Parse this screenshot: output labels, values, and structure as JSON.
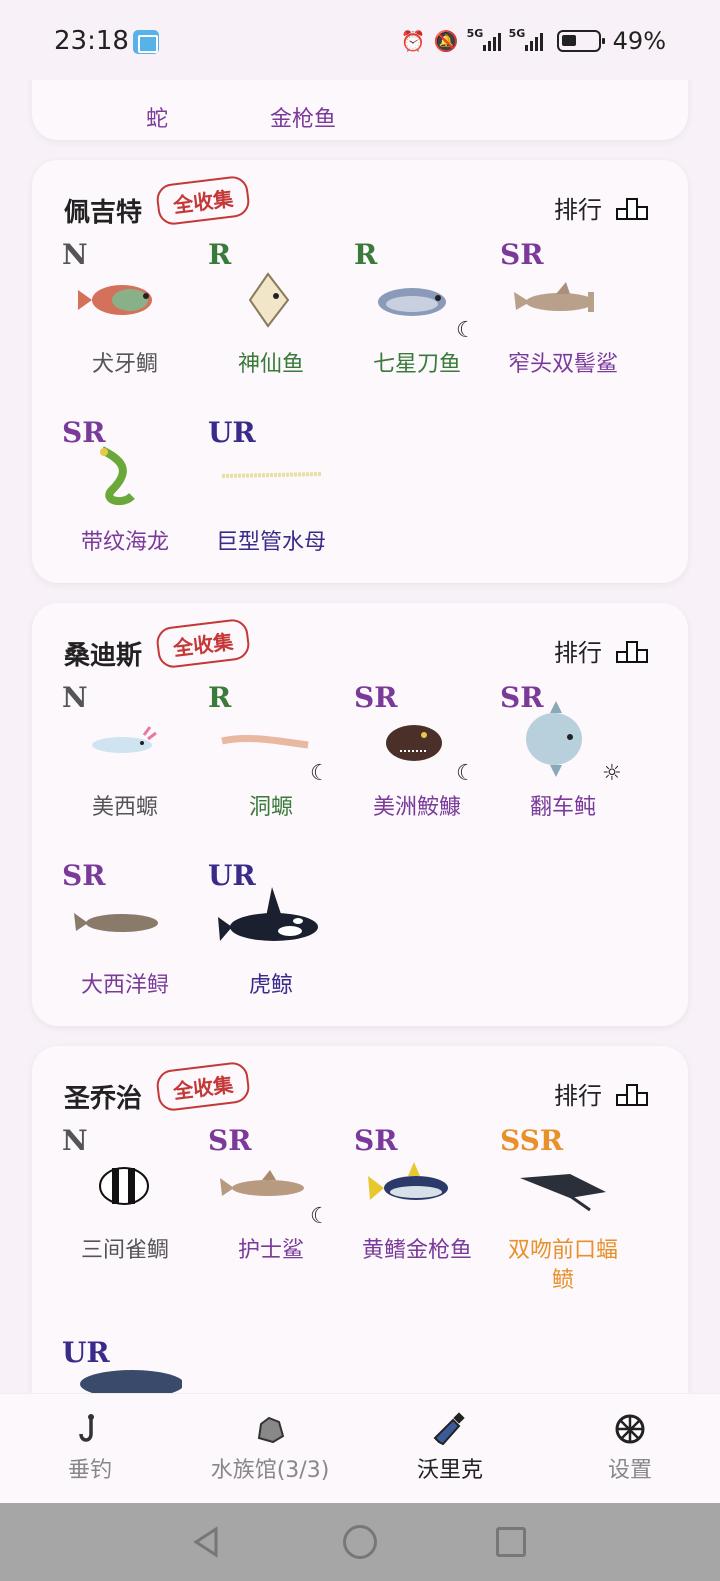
{
  "status_bar": {
    "time": "23:18",
    "battery": "49%",
    "signal_1": "5G",
    "signal_2": "5G",
    "icons": [
      "alarm-icon",
      "mute-icon",
      "signal-icon",
      "signal-icon",
      "battery-icon"
    ]
  },
  "top_card": {
    "fish": [
      {
        "name_line2": "蛇",
        "rarity_color": "#7a3a9a"
      },
      {
        "name_line2": "金枪鱼",
        "rarity_color": "#7a3a9a"
      }
    ]
  },
  "regions": [
    {
      "title": "佩吉特",
      "badge": "全收集",
      "rank_label": "排行",
      "fish": [
        {
          "rarity": "N",
          "name": "犬牙鲷",
          "time": ""
        },
        {
          "rarity": "R",
          "name": "神仙鱼",
          "time": ""
        },
        {
          "rarity": "R",
          "name": "七星刀鱼",
          "time": "☾"
        },
        {
          "rarity": "SR",
          "name": "窄头双髻鲨",
          "time": ""
        },
        {
          "rarity": "SR",
          "name": "带纹海龙",
          "time": ""
        },
        {
          "rarity": "UR",
          "name": "巨型管水母",
          "time": ""
        }
      ]
    },
    {
      "title": "桑迪斯",
      "badge": "全收集",
      "rank_label": "排行",
      "fish": [
        {
          "rarity": "N",
          "name": "美西螈",
          "time": ""
        },
        {
          "rarity": "R",
          "name": "洞螈",
          "time": "☾"
        },
        {
          "rarity": "SR",
          "name": "美洲鮟鱇",
          "time": "☾"
        },
        {
          "rarity": "SR",
          "name": "翻车鲀",
          "time": "☼"
        },
        {
          "rarity": "SR",
          "name": "大西洋鲟",
          "time": ""
        },
        {
          "rarity": "UR",
          "name": "虎鲸",
          "time": ""
        }
      ]
    },
    {
      "title": "圣乔治",
      "badge": "全收集",
      "rank_label": "排行",
      "fish": [
        {
          "rarity": "N",
          "name": "三间雀鲷",
          "time": ""
        },
        {
          "rarity": "SR",
          "name": "护士鲨",
          "time": "☾"
        },
        {
          "rarity": "SR",
          "name": "黄鳍金枪鱼",
          "time": ""
        },
        {
          "rarity": "SSR",
          "name": "双吻前口蝠",
          "name_line2": "鲼",
          "time": ""
        },
        {
          "rarity": "UR",
          "name": "",
          "time": ""
        }
      ]
    }
  ],
  "bottom_nav": [
    {
      "label": "垂钓",
      "icon": "fishing-hook-icon",
      "active": false
    },
    {
      "label": "水族馆(3/3)",
      "icon": "rock-icon",
      "active": false
    },
    {
      "label": "沃里克",
      "icon": "bottle-icon",
      "active": true
    },
    {
      "label": "设置",
      "icon": "settings-ball-icon",
      "active": false
    }
  ],
  "colors": {
    "N": "#555555",
    "R": "#3a7a3a",
    "SR": "#7a3a9a",
    "UR": "#3a2a8a",
    "SSR": "#e8902a",
    "badge": "#c43838"
  }
}
